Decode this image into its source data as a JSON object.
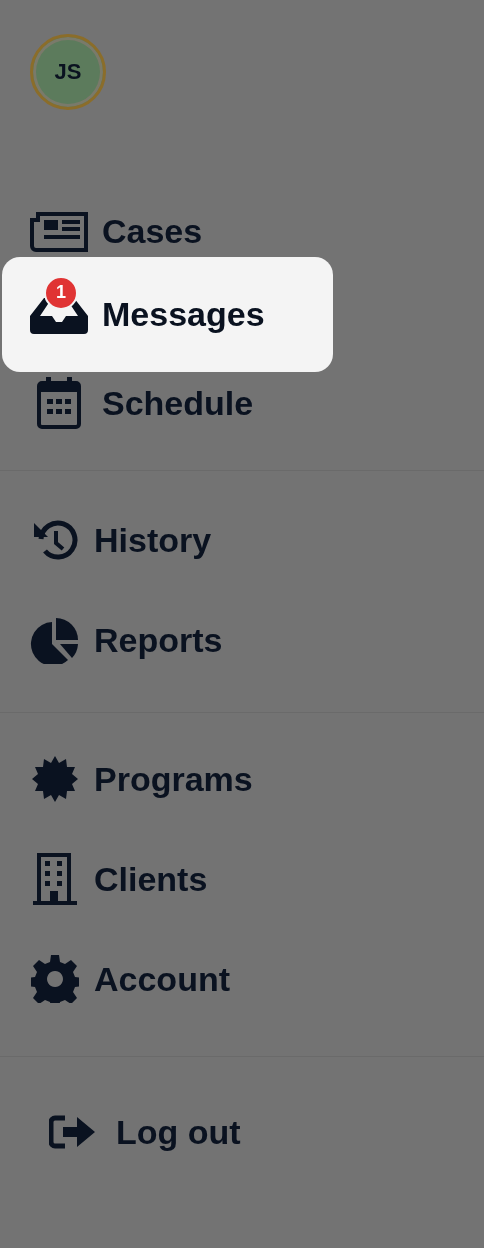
{
  "user": {
    "initials": "JS"
  },
  "sections": [
    {
      "items": [
        {
          "kind": "newspaper",
          "label": "Cases",
          "selected": false
        },
        {
          "kind": "inbox",
          "label": "Messages",
          "selected": true,
          "badge": "1"
        },
        {
          "kind": "calendar",
          "label": "Schedule",
          "selected": false
        }
      ]
    },
    {
      "items": [
        {
          "kind": "history",
          "label": "History",
          "selected": false
        },
        {
          "kind": "piechart",
          "label": "Reports",
          "selected": false
        }
      ]
    },
    {
      "items": [
        {
          "kind": "badge",
          "label": "Programs",
          "selected": false
        },
        {
          "kind": "building",
          "label": "Clients",
          "selected": false
        },
        {
          "kind": "gear",
          "label": "Account",
          "selected": false
        }
      ]
    },
    {
      "items": [
        {
          "kind": "logout",
          "label": "Log out",
          "selected": false
        }
      ]
    }
  ]
}
